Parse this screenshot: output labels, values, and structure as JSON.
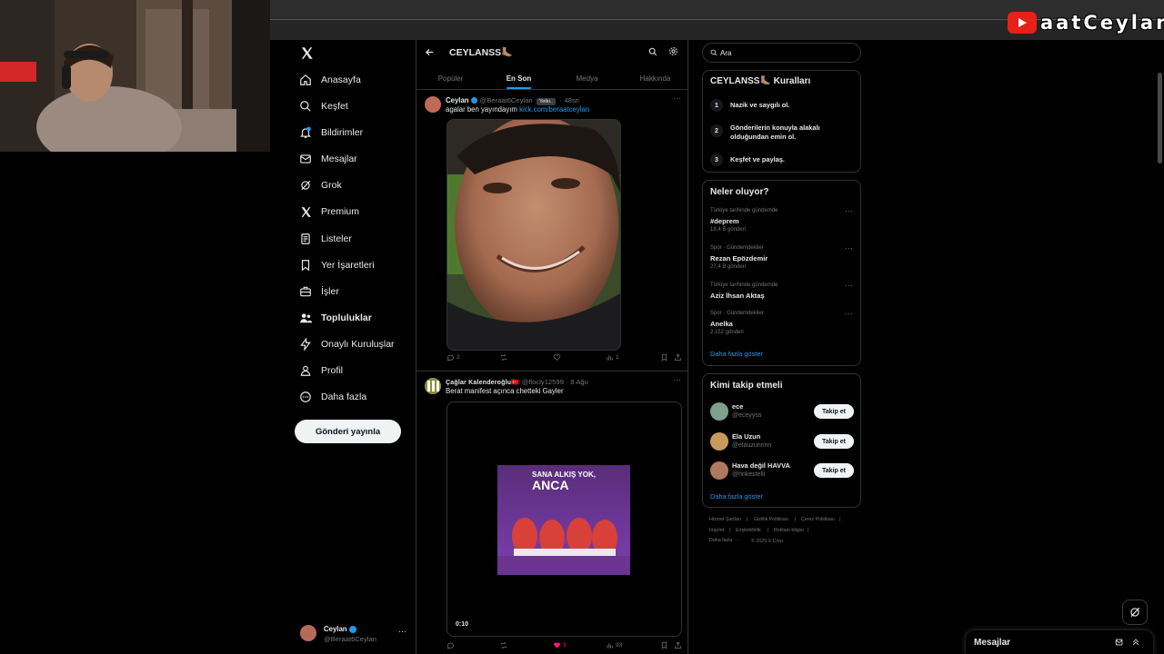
{
  "overlay": {
    "channel_name": "aatCeylan",
    "colors": {
      "youtube_red": "#e62117",
      "accent": "#1d9bf0",
      "like_pink": "#f91880"
    }
  },
  "nav": {
    "logo": "x-logo-icon",
    "items": [
      {
        "label": "Anasayfa",
        "icon": "home-icon"
      },
      {
        "label": "Keşfet",
        "icon": "search-icon"
      },
      {
        "label": "Bildirimler",
        "icon": "bell-icon"
      },
      {
        "label": "Mesajlar",
        "icon": "mail-icon"
      },
      {
        "label": "Grok",
        "icon": "grok-icon"
      },
      {
        "label": "Premium",
        "icon": "x-premium-icon"
      },
      {
        "label": "Listeler",
        "icon": "list-icon"
      },
      {
        "label": "Yer İşaretleri",
        "icon": "bookmark-icon"
      },
      {
        "label": "İşler",
        "icon": "briefcase-icon"
      },
      {
        "label": "Topluluklar",
        "icon": "people-icon"
      },
      {
        "label": "Onaylı Kuruluşlar",
        "icon": "lightning-icon"
      },
      {
        "label": "Profil",
        "icon": "person-icon"
      },
      {
        "label": "Daha fazla",
        "icon": "more-circle-icon"
      }
    ],
    "post_button": "Gönderi yayınla",
    "account": {
      "name": "Ceylan",
      "handle": "@Beraat6Ceylan"
    }
  },
  "header": {
    "title": "CEYLANSS🦶🏽",
    "tabs": [
      "Popüler",
      "En Son",
      "Medya",
      "Hakkında"
    ],
    "active_tab": "En Son"
  },
  "tweets": [
    {
      "name": "Ceylan",
      "handle": "@Beraat6Ceylan",
      "badge": "Yetki..",
      "time": "48sn",
      "text": "agalar ben yayındayım ",
      "link": "kick.com/beraatceylan",
      "stats": {
        "replies": "2",
        "reposts": "",
        "likes": "",
        "views": "1"
      }
    },
    {
      "name": "Çağlar Kalenderoğlu🇹🇷",
      "handle": "@flocly12599",
      "time": "8 Ağu",
      "text": "Berat manifest açınca chetteki Gayler",
      "gif_text_1": "SANA ALKIŞ YOK,",
      "gif_text_2": "ANCA",
      "video_time": "0:10",
      "stats": {
        "replies": "",
        "reposts": "",
        "likes": "3",
        "views": "93"
      }
    }
  ],
  "search": {
    "placeholder": "Ara"
  },
  "rules": {
    "title": "CEYLANSS🦶🏽 Kuralları",
    "items": [
      {
        "num": "1",
        "text": "Nazik ve saygılı ol."
      },
      {
        "num": "2",
        "text": "Gönderilerin konuyla alakalı olduğundan emin ol."
      },
      {
        "num": "3",
        "text": "Keşfet ve paylaş."
      }
    ]
  },
  "trends": {
    "title": "Neler oluyor?",
    "items": [
      {
        "meta": "Türkiye tarihinde gündemde",
        "name": "#deprem",
        "count": "18,4 B gönderi"
      },
      {
        "meta": "Spor · Gündemdekiler",
        "name": "Rezan Epözdemir",
        "count": "27,4 B gönderi"
      },
      {
        "meta": "Türkiye tarihinde gündemde",
        "name": "Aziz İhsan Aktaş",
        "count": ""
      },
      {
        "meta": "Spor · Gündemdekiler",
        "name": "Anelka",
        "count": "2.152 gönderi"
      }
    ],
    "show_more": "Daha fazla göster"
  },
  "who_to_follow": {
    "title": "Kimi takip etmeli",
    "items": [
      {
        "name": "ece",
        "handle": "@eceyyss",
        "button": "Takip et"
      },
      {
        "name": "Ela Uzun",
        "handle": "@elauzunnnn",
        "button": "Takip et"
      },
      {
        "name": "Hava değil HAVVA",
        "handle": "@hnkestelli",
        "button": "Takip et"
      }
    ],
    "show_more": "Daha fazla göster"
  },
  "footer": {
    "links": [
      "Hizmet Şartları",
      "|",
      "Gizlilik Politikası",
      "|",
      "Çerez Politikası",
      "|",
      "Imprint",
      "|",
      "Erişilebilirlik",
      "|",
      "Reklam bilgisi",
      "|",
      "Daha fazla ···",
      "© 2025 X Corp."
    ]
  },
  "messages_drawer": {
    "label": "Mesajlar"
  }
}
